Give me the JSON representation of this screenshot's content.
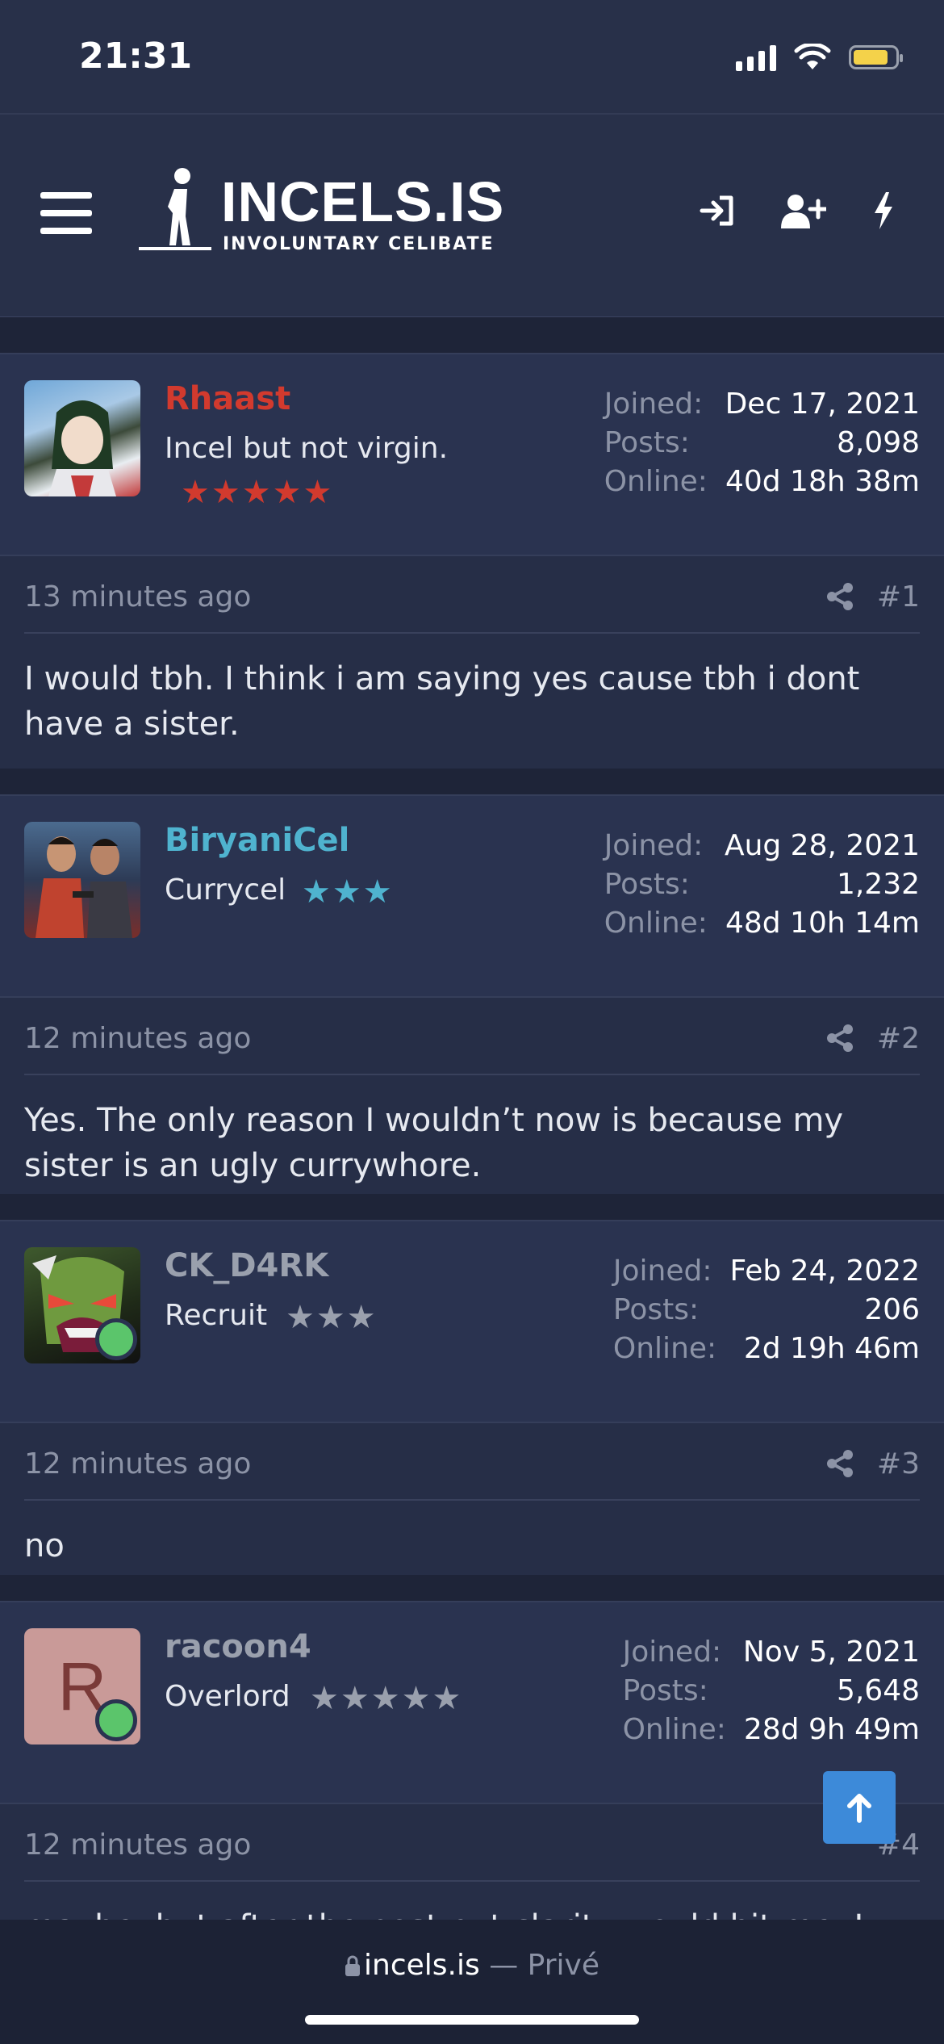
{
  "status_bar": {
    "time": "21:31"
  },
  "header": {
    "logo_title": "INCELS.IS",
    "logo_subtitle": "INVOLUNTARY CELIBATE"
  },
  "posts": [
    {
      "username": "Rhaast",
      "username_color": "#d23a2e",
      "user_title": "Incel but not virgin.",
      "stars": "★★★★★",
      "star_color": "#d23a2e",
      "joined_label": "Joined:",
      "joined": "Dec 17, 2021",
      "posts_label": "Posts:",
      "posts": "8,098",
      "online_label": "Online:",
      "online": "40d 18h 38m",
      "time_ago": "13 minutes ago",
      "number": "#1",
      "body": "I would tbh. I think i am saying yes cause tbh i dont have a sister."
    },
    {
      "username": "BiryaniCel",
      "username_color": "#4fb3cf",
      "user_title": "Currycel",
      "stars": "★★★",
      "star_color": "#4fb3cf",
      "joined_label": "Joined:",
      "joined": "Aug 28, 2021",
      "posts_label": "Posts:",
      "posts": "1,232",
      "online_label": "Online:",
      "online": "48d 10h 14m",
      "time_ago": "12 minutes ago",
      "number": "#2",
      "body": "Yes. The only reason I wouldn’t now is because my sister is an ugly currywhore."
    },
    {
      "username": "CK_D4RK",
      "username_color": "#9aa0ad",
      "user_title": "Recruit",
      "stars": "★★★",
      "star_color": "#9aa0ad",
      "joined_label": "Joined:",
      "joined": "Feb 24, 2022",
      "posts_label": "Posts:",
      "posts": "206",
      "online_label": "Online:",
      "online": "2d 19h 46m",
      "time_ago": "12 minutes ago",
      "number": "#3",
      "body": "no"
    },
    {
      "username": "racoon4",
      "username_color": "#9aa0ad",
      "avatar_letter": "R",
      "user_title": "Overlord",
      "stars": "★★★★★",
      "star_color": "#9aa0ad",
      "joined_label": "Joined:",
      "joined": "Nov 5, 2021",
      "posts_label": "Posts:",
      "posts": "5,648",
      "online_label": "Online:",
      "online": "28d 9h 49m",
      "time_ago": "12 minutes ago",
      "number": "#4",
      "body": "maybe, but after the post nut clarity would hit me, I"
    }
  ],
  "url_bar": {
    "domain": "incels.is",
    "separator": "—",
    "mode": "Privé"
  }
}
